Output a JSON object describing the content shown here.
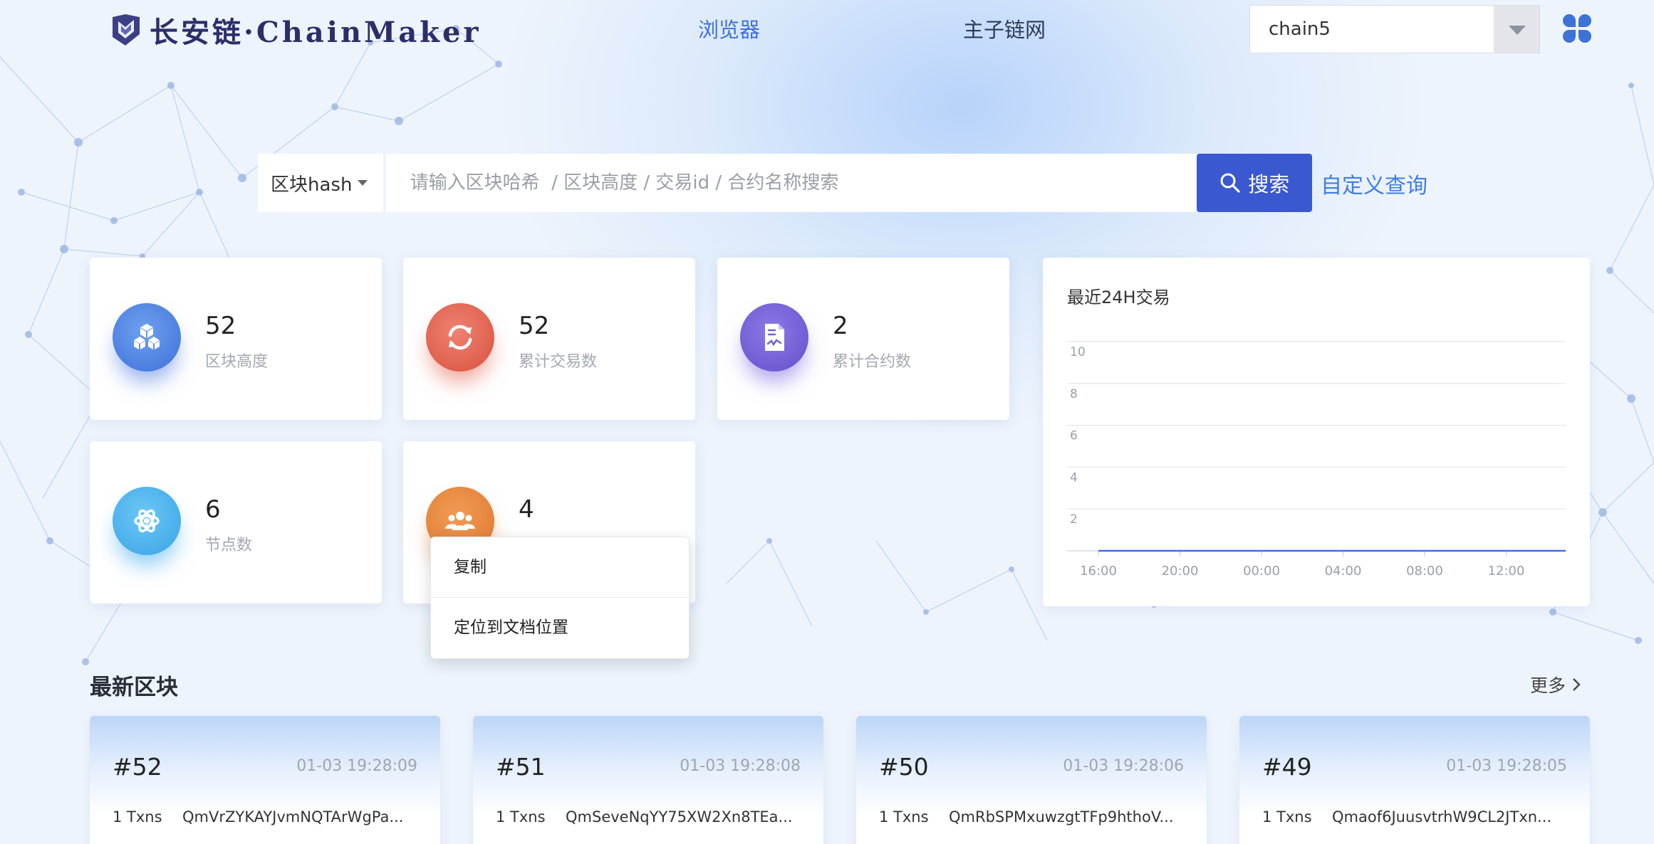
{
  "header": {
    "logo_text": "长安链·ChainMaker",
    "nav": [
      {
        "label": "浏览器",
        "active": true
      },
      {
        "label": "主子链网",
        "active": false
      }
    ],
    "chain_select": {
      "value": "chain5"
    },
    "apps_icon": "grid-apps-icon"
  },
  "search": {
    "type_label": "区块hash",
    "placeholder": "请输入区块哈希  / 区块高度 / 交易id / 合约名称搜索",
    "button_label": "搜索",
    "custom_query": "自定义查询"
  },
  "stats": [
    {
      "value": "52",
      "label": "区块高度",
      "icon": "cubes-icon",
      "color": "#4a7ee0"
    },
    {
      "value": "52",
      "label": "累计交易数",
      "icon": "refresh-icon",
      "color": "#e0604c"
    },
    {
      "value": "2",
      "label": "累计合约数",
      "icon": "document-icon",
      "color": "#735cd8"
    },
    {
      "value": "6",
      "label": "节点数",
      "icon": "gear-atom-icon",
      "color": "#4ab2ef"
    },
    {
      "value": "4",
      "label": "",
      "icon": "users-icon",
      "color": "#e88a3e"
    }
  ],
  "context_menu": {
    "items": [
      "复制",
      "定位到文档位置"
    ]
  },
  "chart": {
    "title": "最近24H交易"
  },
  "chart_data": {
    "type": "line",
    "title": "最近24H交易",
    "x": [
      "16:00",
      "20:00",
      "00:00",
      "04:00",
      "08:00",
      "12:00"
    ],
    "series": [
      {
        "values": [
          0,
          0,
          0,
          0,
          0,
          0
        ]
      }
    ],
    "yticks": [
      2,
      4,
      6,
      8,
      10
    ],
    "ylim": [
      0,
      10
    ],
    "grid": true,
    "line_color": "#3e6fe0"
  },
  "latest_blocks": {
    "title": "最新区块",
    "more": "更多",
    "blocks": [
      {
        "number": "#52",
        "time": "01-03 19:28:09",
        "txns": "1 Txns",
        "hash": "QmVrZYKAYJvmNQTArWgPa..."
      },
      {
        "number": "#51",
        "time": "01-03 19:28:08",
        "txns": "1 Txns",
        "hash": "QmSeveNqYY75XW2Xn8TEa..."
      },
      {
        "number": "#50",
        "time": "01-03 19:28:06",
        "txns": "1 Txns",
        "hash": "QmRbSPMxuwzgtTFp9hthoV..."
      },
      {
        "number": "#49",
        "time": "01-03 19:28:05",
        "txns": "1 Txns",
        "hash": "Qmaof6JuusvtrhW9CL2JTxn..."
      }
    ]
  }
}
